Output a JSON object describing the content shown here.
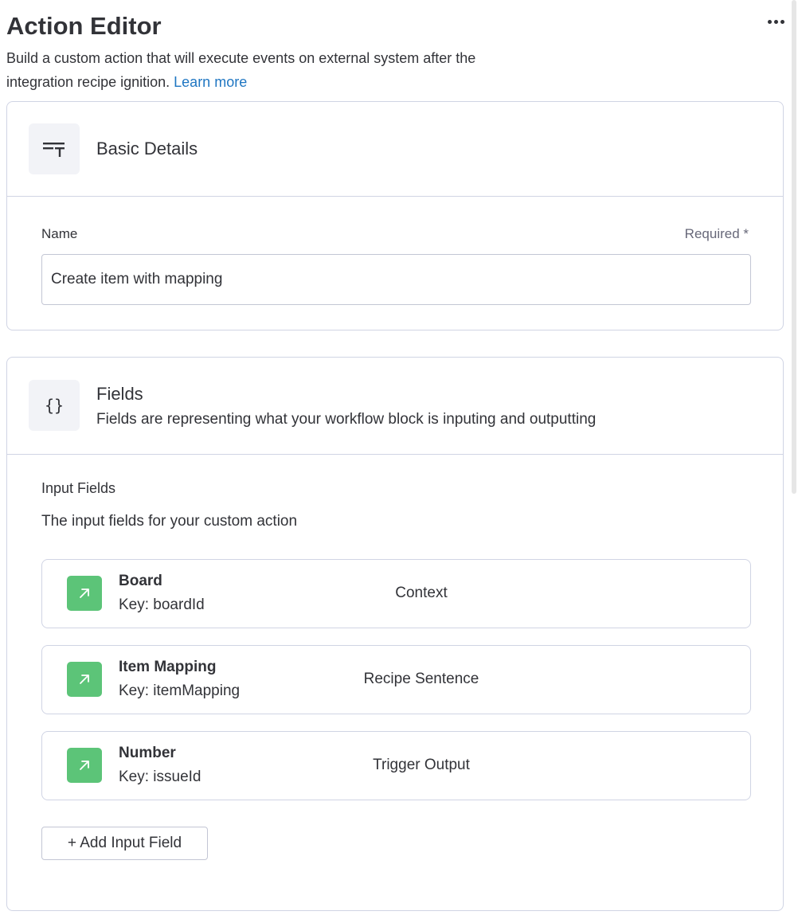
{
  "header": {
    "title": "Action Editor",
    "subtitle": "Build a custom action that will execute events on external system after the integration recipe ignition.",
    "learn_more": "Learn more",
    "more_icon": "more-horizontal-icon"
  },
  "basic_details": {
    "title": "Basic Details",
    "icon": "text-format-icon",
    "name_label": "Name",
    "required_label": "Required *",
    "name_value": "Create item with mapping"
  },
  "fields": {
    "title": "Fields",
    "icon": "curly-braces-icon",
    "icon_text": "{}",
    "description": "Fields are representing what your workflow block is inputing and outputting",
    "input_fields_title": "Input Fields",
    "input_fields_desc": "The input fields for your custom action",
    "items": [
      {
        "name": "Board",
        "key": "Key: boardId",
        "type": "Context",
        "icon": "arrow-up-right-icon"
      },
      {
        "name": "Item Mapping",
        "key": "Key: itemMapping",
        "type": "Recipe Sentence",
        "icon": "arrow-up-right-icon"
      },
      {
        "name": "Number",
        "key": "Key: issueId",
        "type": "Trigger Output",
        "icon": "arrow-up-right-icon"
      }
    ],
    "add_button": "+ Add Input Field"
  },
  "colors": {
    "accent_link": "#1f76c2",
    "field_icon_bg": "#5cc478",
    "border": "#d0d4e4",
    "text": "#323338"
  }
}
